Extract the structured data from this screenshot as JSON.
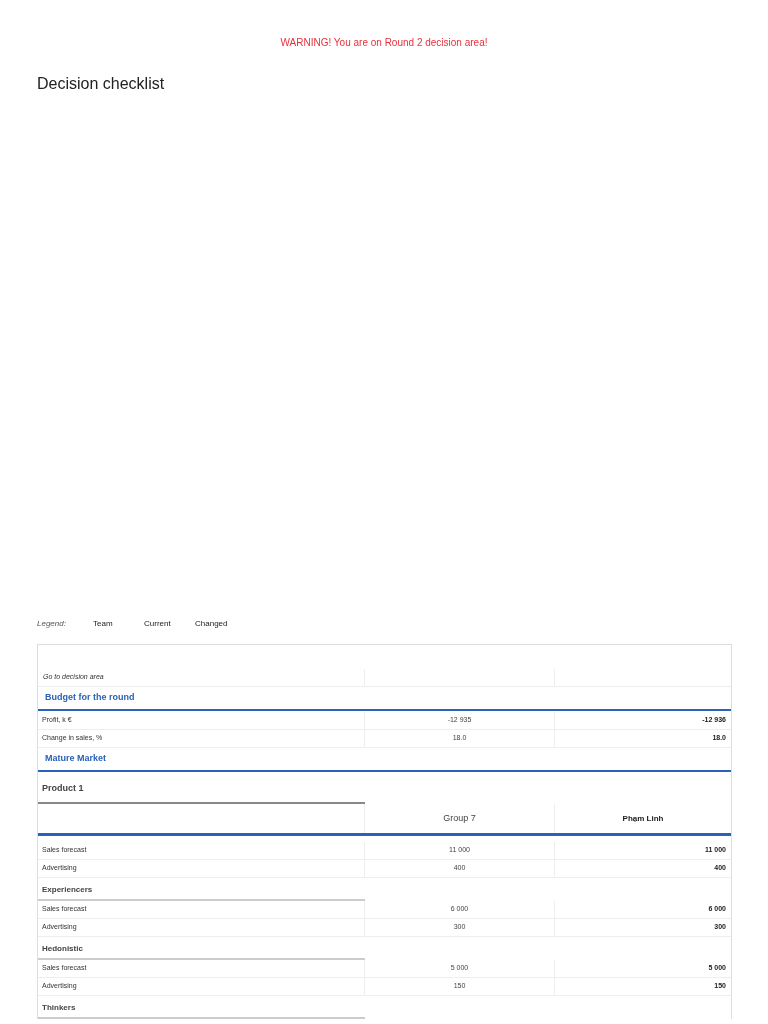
{
  "warning": "WARNING! You are on Round 2 decision area!",
  "title": "Decision checklist",
  "legend": {
    "label": "Legend:",
    "items": [
      "Team",
      "Current",
      "Changed"
    ]
  },
  "rows": [
    {
      "kind": "link",
      "label": "Go to decision area"
    },
    {
      "kind": "section",
      "label": "Budget for the round"
    },
    {
      "kind": "row",
      "label": "Profit, k €",
      "team": "-12 935",
      "current": "-12 936"
    },
    {
      "kind": "row",
      "label": "Change in sales, %",
      "team": "18.0",
      "current": "18.0"
    },
    {
      "kind": "section",
      "label": "Mature Market"
    },
    {
      "kind": "product",
      "label": "Product 1"
    },
    {
      "kind": "header",
      "team": "Group 7",
      "current": "Phạm Linh"
    },
    {
      "kind": "row",
      "label": "Sales forecast",
      "team": "11 000",
      "current": "11 000"
    },
    {
      "kind": "row",
      "label": "Advertising",
      "team": "400",
      "current": "400"
    },
    {
      "kind": "group",
      "label": "Experiencers"
    },
    {
      "kind": "row",
      "label": "Sales forecast",
      "team": "6 000",
      "current": "6 000"
    },
    {
      "kind": "row",
      "label": "Advertising",
      "team": "300",
      "current": "300"
    },
    {
      "kind": "group",
      "label": "Hedonistic"
    },
    {
      "kind": "row",
      "label": "Sales forecast",
      "team": "5 000",
      "current": "5 000"
    },
    {
      "kind": "row",
      "label": "Advertising",
      "team": "150",
      "current": "150"
    },
    {
      "kind": "group",
      "label": "Thinkers"
    }
  ]
}
